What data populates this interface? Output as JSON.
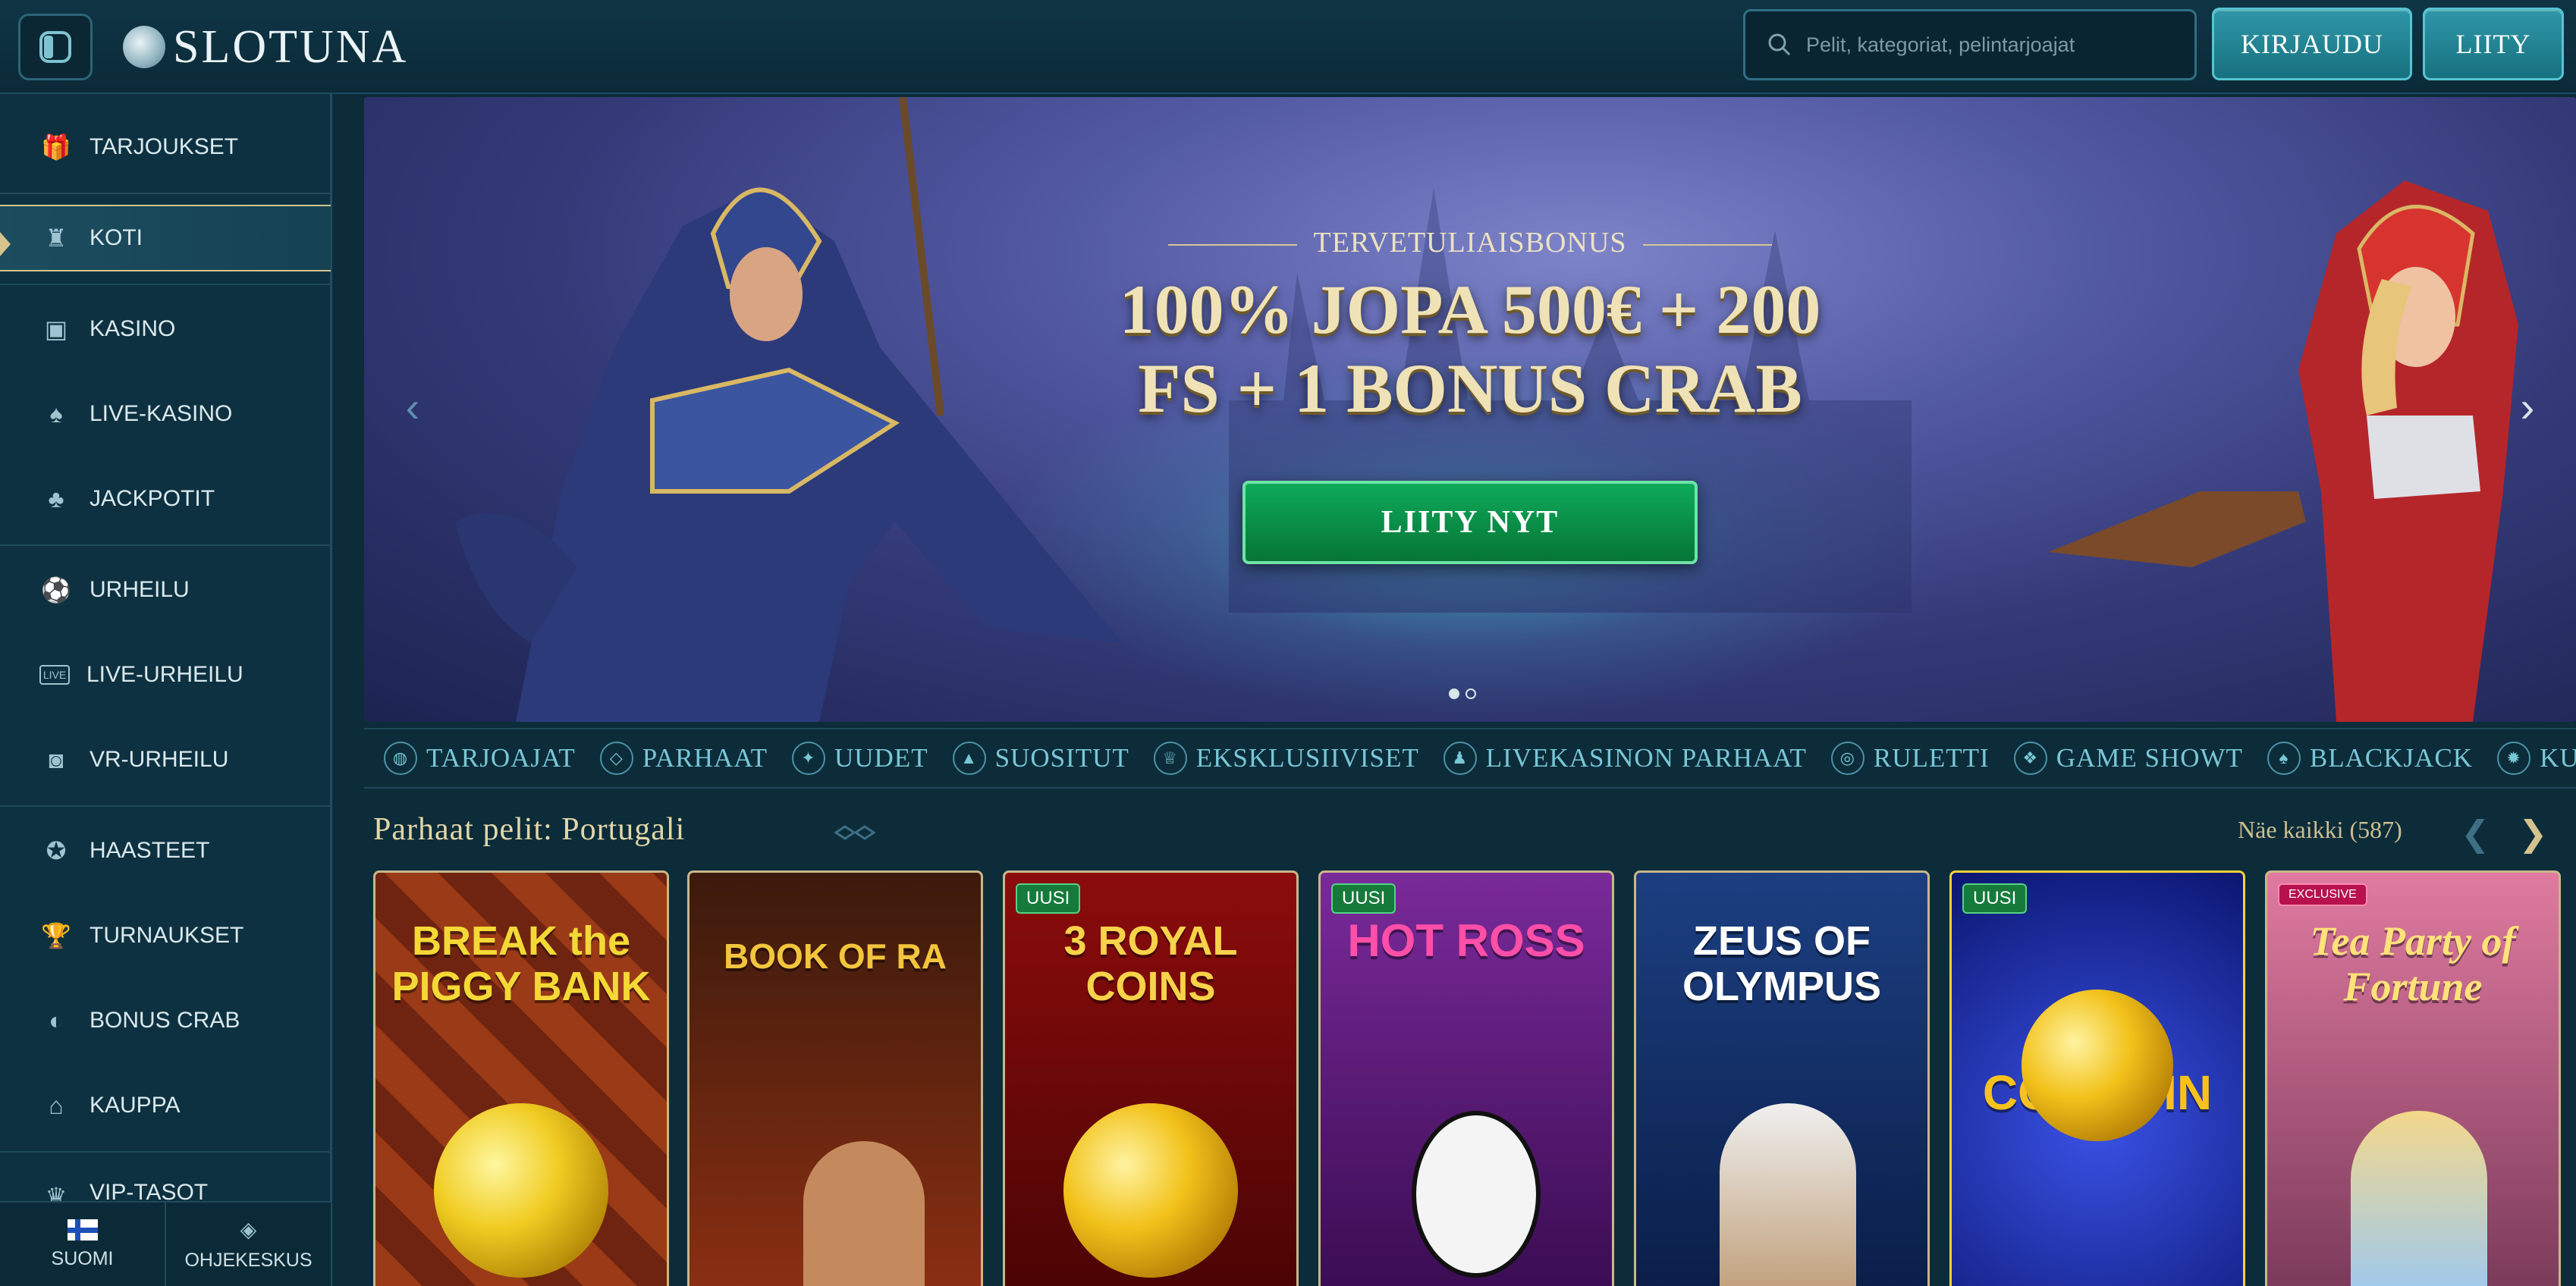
{
  "header": {
    "logo_text": "SLOTUNA",
    "search_placeholder": "Pelit, kategoriat, pelintarjoajat",
    "login_label": "KIRJAUDU",
    "join_label": "LIITY"
  },
  "sidebar": {
    "items": [
      {
        "label": "TARJOUKSET",
        "icon": "gift-icon"
      },
      {
        "label": "KOTI",
        "icon": "castle-icon",
        "active": true
      },
      {
        "label": "KASINO",
        "icon": "slot-machine-icon"
      },
      {
        "label": "LIVE-KASINO",
        "icon": "cards-icon"
      },
      {
        "label": "JACKPOTIT",
        "icon": "clover-icon"
      },
      {
        "label": "URHEILU",
        "icon": "soccer-ball-icon"
      },
      {
        "label": "LIVE-URHEILU",
        "icon": "live-badge-icon"
      },
      {
        "label": "VR-URHEILU",
        "icon": "vr-sport-icon"
      },
      {
        "label": "HAASTEET",
        "icon": "badge-icon"
      },
      {
        "label": "TURNAUKSET",
        "icon": "trophy-icon"
      },
      {
        "label": "BONUS CRAB",
        "icon": "crab-claw-icon"
      },
      {
        "label": "KAUPPA",
        "icon": "shop-icon"
      },
      {
        "label": "VIP-TASOT",
        "icon": "crown-icon"
      }
    ],
    "language_label": "SUOMI",
    "help_label": "OHJEKESKUS"
  },
  "banner": {
    "kicker": "TERVETULIAISBONUS",
    "title_line1": "100% JOPA 500€ + 200",
    "title_line2": "FS + 1 BONUS CRAB",
    "cta_label": "LIITY NYT",
    "slide_count": 2,
    "active_slide": 1
  },
  "categories": [
    "TARJOAJAT",
    "PARHAAT",
    "UUDET",
    "SUOSITUT",
    "EKSKLUSIIVISET",
    "LIVEKASINON PARHAAT",
    "RULETTI",
    "GAME SHOWT",
    "BLACKJACK",
    "KUUM"
  ],
  "games_section": {
    "title": "Parhaat pelit: Portugali",
    "see_all": "Näe kaikki (587)",
    "new_badge": "UUSI",
    "games": [
      {
        "name": "BREAK the PIGGY BANK",
        "badge": "",
        "color_top": "#8a2a14",
        "color_bottom": "#4a1208",
        "text_color": "#f4d936"
      },
      {
        "name": "BOOK OF RA",
        "badge": "",
        "color_top": "#3b1a0c",
        "color_bottom": "#8b2f12",
        "text_color": "#f2c53d"
      },
      {
        "name": "3 ROYAL COINS",
        "badge": "UUSI",
        "color_top": "#8c0c0c",
        "color_bottom": "#4a0404",
        "text_color": "#f7d24a"
      },
      {
        "name": "HOT ROSS",
        "badge": "UUSI",
        "color_top": "#6a1a8a",
        "color_bottom": "#3a0c52",
        "text_color": "#ff4fa8"
      },
      {
        "name": "ZEUS OF OLYMPUS",
        "badge": "",
        "color_top": "#1c3f82",
        "color_bottom": "#0a1e48",
        "text_color": "#ffffff"
      },
      {
        "name": "COIN WIN",
        "badge": "UUSI",
        "color_top": "#1a2fb8",
        "color_bottom": "#0b1670",
        "text_color": "#f8c21d"
      },
      {
        "name": "Tea Party of Fortune",
        "badge": "EXCLUSIVE",
        "color_top": "#d86b95",
        "color_bottom": "#7a3a5a",
        "text_color": "#ffe27a"
      }
    ]
  }
}
